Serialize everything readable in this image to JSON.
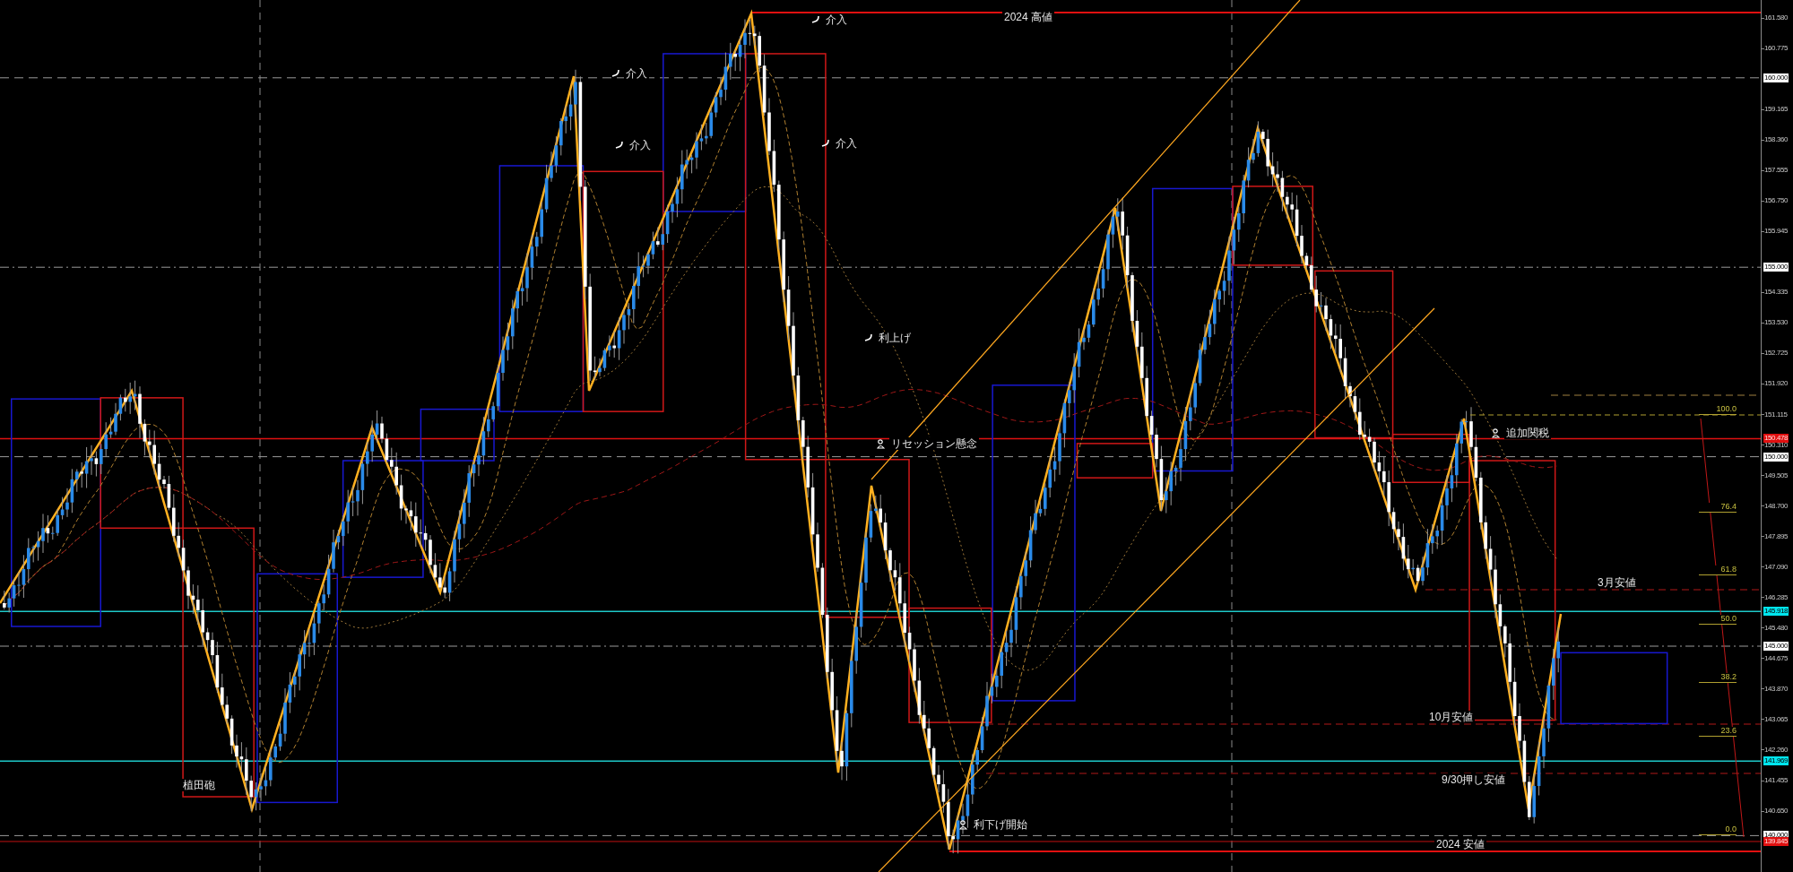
{
  "chart": {
    "annotations": [
      {
        "text": "2024 高値",
        "kind": "plain"
      },
      {
        "text": "介入",
        "kind": "intervention"
      },
      {
        "text": "介入",
        "kind": "intervention"
      },
      {
        "text": "介入",
        "kind": "intervention"
      },
      {
        "text": "介入",
        "kind": "intervention"
      },
      {
        "text": "利上げ",
        "kind": "intervention"
      },
      {
        "text": "リセッション懸念",
        "kind": "note"
      },
      {
        "text": "追加関税",
        "kind": "note"
      },
      {
        "text": "3月安値",
        "kind": "plain"
      },
      {
        "text": "10月安値",
        "kind": "plain"
      },
      {
        "text": "9/30押し安値",
        "kind": "plain"
      },
      {
        "text": "2024 安値",
        "kind": "plain"
      },
      {
        "text": "植田砲",
        "kind": "plain"
      },
      {
        "text": "利下げ開始",
        "kind": "note"
      }
    ],
    "fib_levels": [
      "100.0",
      "76.4",
      "61.8",
      "50.0",
      "38.2",
      "23.6",
      "0.0"
    ]
  },
  "price_axis": {
    "ticks": [
      "161.580",
      "160.775",
      "159.165",
      "158.360",
      "157.555",
      "156.750",
      "155.945",
      "154.335",
      "153.530",
      "152.725",
      "151.920",
      "151.115",
      "150.310",
      "149.505",
      "148.700",
      "147.895",
      "147.090",
      "146.285",
      "145.480",
      "144.675",
      "143.870",
      "143.065",
      "142.260",
      "141.455",
      "140.650"
    ],
    "markers": [
      {
        "text": "160.000",
        "kind": "level"
      },
      {
        "text": "155.000",
        "kind": "level"
      },
      {
        "text": "150.478",
        "kind": "alert"
      },
      {
        "text": "150.000",
        "kind": "level"
      },
      {
        "text": "145.918",
        "kind": "cyan"
      },
      {
        "text": "145.000",
        "kind": "level"
      },
      {
        "text": "141.969",
        "kind": "cyan"
      },
      {
        "text": "140.000",
        "kind": "level"
      },
      {
        "text": "139.845",
        "kind": "alert"
      }
    ]
  }
}
